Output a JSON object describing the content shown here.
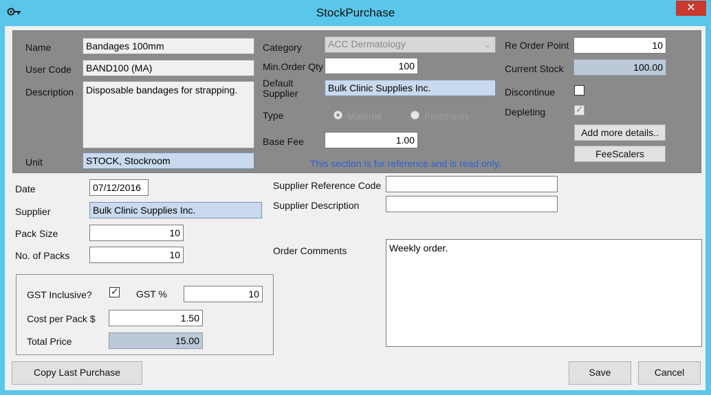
{
  "window": {
    "title": "StockPurchase",
    "close_glyph": "✕",
    "icon": "key-icon"
  },
  "reference": {
    "name_label": "Name",
    "name_value": "Bandages 100mm",
    "user_code_label": "User Code",
    "user_code_value": "BAND100 (MA)",
    "description_label": "Description",
    "description_value": "Disposable bandages for strapping.",
    "unit_label": "Unit",
    "unit_value": "STOCK, Stockroom",
    "category_label": "Category",
    "category_value": "ACC Dermatology",
    "min_order_label": "Min.Order Qty",
    "min_order_value": "100",
    "default_supplier_label": "Default Supplier",
    "default_supplier_value": "Bulk Clinic Supplies Inc.",
    "type_label": "Type",
    "type_material": "Material",
    "type_prosthesis": "Prosthesis",
    "base_fee_label": "Base Fee",
    "base_fee_value": "1.00",
    "reorder_label": "Re Order Point",
    "reorder_value": "10",
    "current_stock_label": "Current Stock",
    "current_stock_value": "100.00",
    "discontinue_label": "Discontinue",
    "discontinue_checked": false,
    "depleting_label": "Depleting",
    "depleting_checked": true,
    "add_details_button": "Add more details..",
    "fee_scalers_button": "FeeScalers",
    "note": "This section is for reference and is read only."
  },
  "purchase": {
    "date_label": "Date",
    "date_value": "07/12/2016",
    "supplier_label": "Supplier",
    "supplier_value": "Bulk Clinic Supplies Inc.",
    "pack_size_label": "Pack Size",
    "pack_size_value": "10",
    "packs_label": "No. of Packs",
    "packs_value": "10",
    "supplier_ref_label": "Supplier Reference Code",
    "supplier_ref_value": "",
    "supplier_desc_label": "Supplier Description",
    "supplier_desc_value": "",
    "comments_label": "Order Comments",
    "comments_value": "Weekly order.",
    "gst_inclusive_label": "GST Inclusive?",
    "gst_inclusive_checked": true,
    "gst_pct_label": "GST %",
    "gst_pct_value": "10",
    "cost_per_pack_label": "Cost per Pack $",
    "cost_per_pack_value": "1.50",
    "total_price_label": "Total Price",
    "total_price_value": "15.00"
  },
  "buttons": {
    "copy_last": "Copy Last Purchase",
    "save": "Save",
    "cancel": "Cancel"
  },
  "colors": {
    "titlebar": "#59c6ea",
    "reference_panel": "#8a8a8a",
    "note_text": "#2b62d6",
    "close": "#c9382e"
  }
}
